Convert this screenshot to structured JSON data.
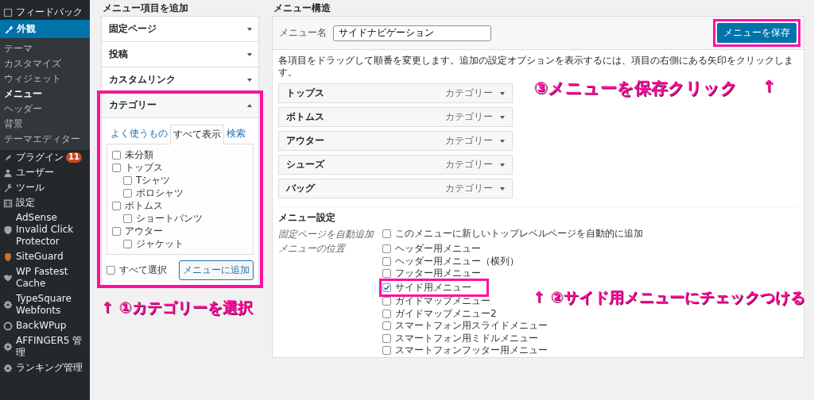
{
  "sidebar": {
    "items": [
      {
        "label": "フィードバック",
        "selected": false
      },
      {
        "label": "外観",
        "selected": true,
        "children": [
          {
            "label": "テーマ",
            "selected": false
          },
          {
            "label": "カスタマイズ",
            "selected": false
          },
          {
            "label": "ウィジェット",
            "selected": false
          },
          {
            "label": "メニュー",
            "selected": true
          },
          {
            "label": "ヘッダー",
            "selected": false
          },
          {
            "label": "背景",
            "selected": false
          },
          {
            "label": "テーマエディター",
            "selected": false
          }
        ]
      },
      {
        "label": "プラグイン",
        "selected": false,
        "badge": "11"
      },
      {
        "label": "ユーザー",
        "selected": false
      },
      {
        "label": "ツール",
        "selected": false
      },
      {
        "label": "設定",
        "selected": false
      },
      {
        "label": "AdSense Invalid Click Protector",
        "selected": false
      },
      {
        "label": "SiteGuard",
        "selected": false
      },
      {
        "label": "WP Fastest Cache",
        "selected": false
      },
      {
        "label": "TypeSquare Webfonts",
        "selected": false
      },
      {
        "label": "BackWPup",
        "selected": false
      },
      {
        "label": "AFFINGER5 管理",
        "selected": false
      },
      {
        "label": "ランキング管理",
        "selected": false
      }
    ]
  },
  "add_items": {
    "heading": "メニュー項目を追加",
    "panels": [
      {
        "title": "固定ページ",
        "expanded": false
      },
      {
        "title": "投稿",
        "expanded": false
      },
      {
        "title": "カスタムリンク",
        "expanded": false
      },
      {
        "title": "カテゴリー",
        "expanded": true,
        "highlighted": true,
        "tabs": [
          {
            "label": "よく使うもの",
            "selected": false
          },
          {
            "label": "すべて表示",
            "selected": true
          },
          {
            "label": "検索",
            "selected": false
          }
        ],
        "checklist": [
          {
            "label": "未分類",
            "checked": false
          },
          {
            "label": "トップス",
            "checked": false,
            "children": [
              {
                "label": "Tシャツ",
                "checked": false
              },
              {
                "label": "ポロシャツ",
                "checked": false
              }
            ]
          },
          {
            "label": "ボトムス",
            "checked": false,
            "children": [
              {
                "label": "ショートパンツ",
                "checked": false
              }
            ]
          },
          {
            "label": "アウター",
            "checked": false,
            "children": [
              {
                "label": "ジャケット",
                "checked": false
              }
            ]
          }
        ],
        "select_all": {
          "label": "すべて選択",
          "checked": false
        },
        "button": "メニューに追加"
      }
    ],
    "note": "↑ ①カテゴリーを選択"
  },
  "structure": {
    "heading": "メニュー構造",
    "name_label": "メニュー名",
    "name_value": "サイドナビゲーション",
    "save_button": {
      "label": "メニューを保存",
      "highlighted": true
    },
    "description": "各項目をドラッグして順番を変更します。追加の設定オプションを表示するには、項目の右側にある矢印をクリックします。",
    "note": "③メニューを保存クリック",
    "note_arrow": "↑",
    "items": [
      {
        "title": "トップス",
        "type": "カテゴリー"
      },
      {
        "title": "ボトムス",
        "type": "カテゴリー"
      },
      {
        "title": "アウター",
        "type": "カテゴリー"
      },
      {
        "title": "シューズ",
        "type": "カテゴリー"
      },
      {
        "title": "バッグ",
        "type": "カテゴリー"
      }
    ],
    "settings": {
      "heading": "メニュー設定",
      "auto_add": {
        "label": "固定ページを自動追加",
        "option": "このメニューに新しいトップレベルページを自動的に追加",
        "checked": false
      },
      "locations_label": "メニューの位置",
      "locations": [
        {
          "label": "ヘッダー用メニュー",
          "checked": false,
          "highlighted": false
        },
        {
          "label": "ヘッダー用メニュー（横列）",
          "checked": false,
          "highlighted": false
        },
        {
          "label": "フッター用メニュー",
          "checked": false,
          "highlighted": false
        },
        {
          "label": "サイド用メニュー",
          "checked": true,
          "highlighted": true
        },
        {
          "label": "ガイドマップメニュー",
          "checked": false,
          "highlighted": false
        },
        {
          "label": "ガイドマップメニュー2",
          "checked": false,
          "highlighted": false
        },
        {
          "label": "スマートフォン用スライドメニュー",
          "checked": false,
          "highlighted": false
        },
        {
          "label": "スマートフォン用ミドルメニュー",
          "checked": false,
          "highlighted": false
        },
        {
          "label": "スマートフォンフッター用メニュー",
          "checked": false,
          "highlighted": false
        }
      ],
      "note": "↑ ②サイド用メニューにチェックつける"
    }
  }
}
